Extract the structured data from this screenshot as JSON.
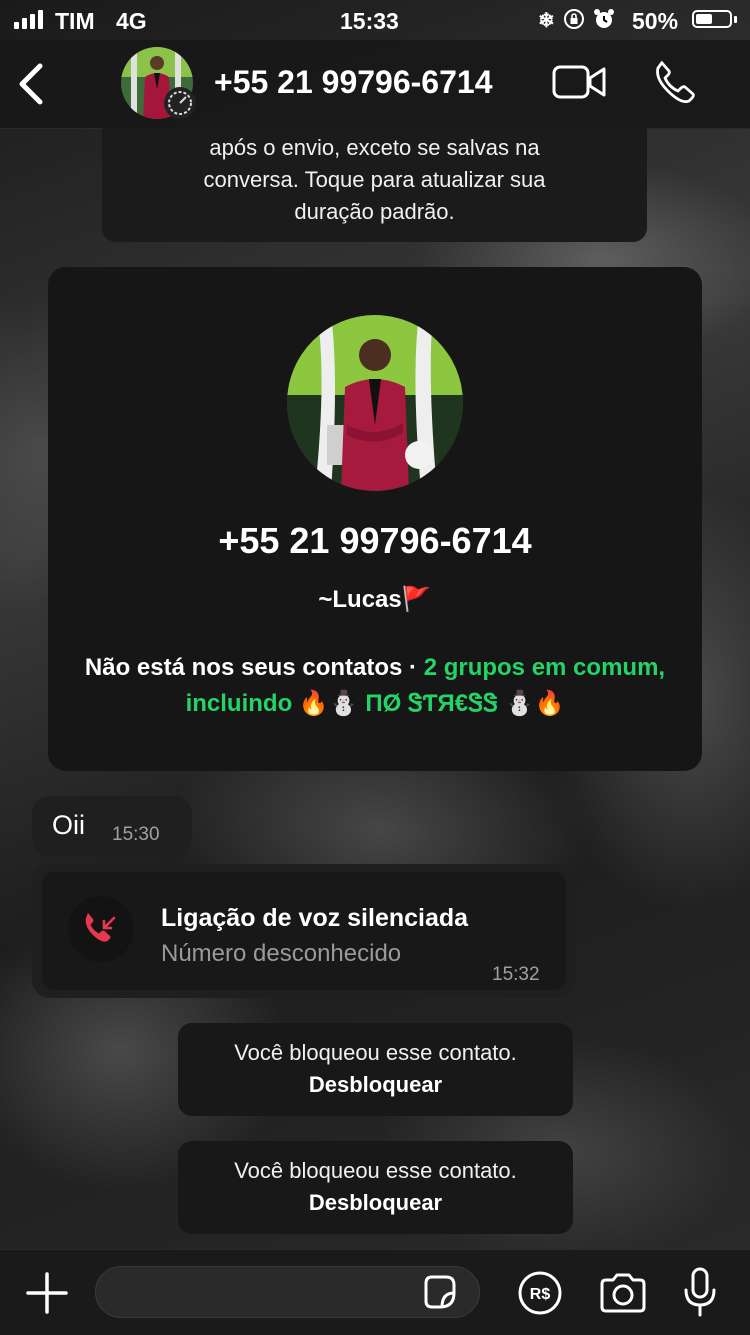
{
  "status_bar": {
    "carrier": "TIM",
    "network": "4G",
    "time": "15:33",
    "battery_percent": "50%",
    "battery_level": 0.5,
    "icons": [
      "snowflake-icon",
      "orientation-lock-icon",
      "alarm-icon"
    ]
  },
  "header": {
    "title": "+55 21 99796-6714",
    "back_icon": "chevron-left-icon",
    "video_icon": "video-camera-icon",
    "call_icon": "phone-icon"
  },
  "disappearing_notice": {
    "text_line1": "após o envio, exceto se salvas na",
    "text_line2": "conversa. Toque para atualizar sua",
    "text_line3": "duração padrão."
  },
  "profile_card": {
    "phone": "+55 21 99796-6714",
    "name": "~Lucas🚩",
    "info_plain": "Não está nos seus contatos · ",
    "info_highlight": "2 grupos em comum, incluindo 🔥⛄ ПØ ᏕƬЯ€ᏕᏕ ⛄🔥",
    "accent_color": "#25d366"
  },
  "messages": {
    "incoming_text": {
      "text": "Oii",
      "time": "15:30"
    },
    "call": {
      "title": "Ligação de voz silenciada",
      "subtitle": "Número desconhecido",
      "time": "15:32",
      "icon": "missed-call-icon",
      "icon_color": "#e8384f"
    }
  },
  "blocked_notices": [
    {
      "text": "Você bloqueou esse contato.",
      "action": "Desbloquear"
    },
    {
      "text": "Você bloqueou esse contato.",
      "action": "Desbloquear"
    }
  ],
  "input_bar": {
    "placeholder": "",
    "icons": [
      "plus-icon",
      "sticker-icon",
      "pix-icon",
      "camera-icon",
      "microphone-icon"
    ]
  }
}
